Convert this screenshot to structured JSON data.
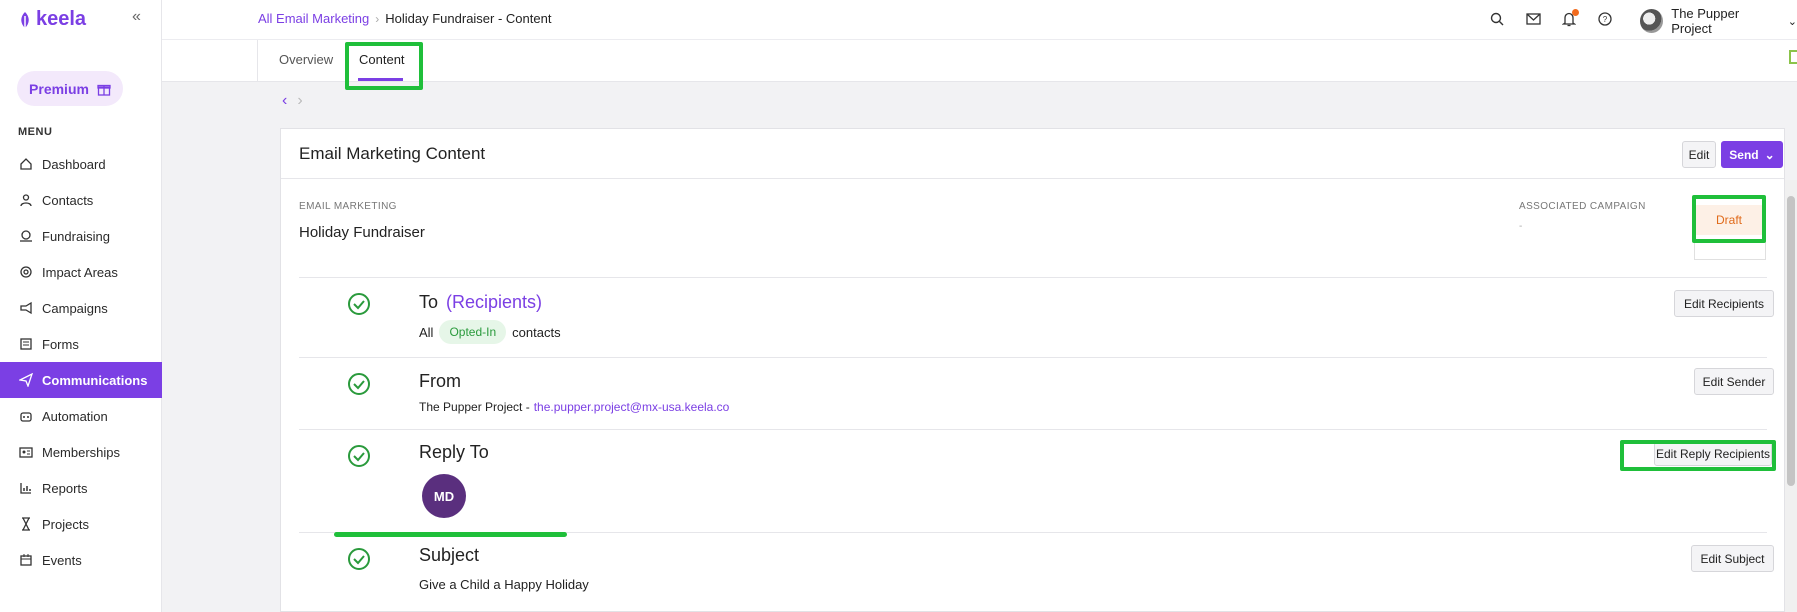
{
  "app": {
    "logo_text": "keela",
    "collapse_icon": "double-chevron-left-icon"
  },
  "sidebar": {
    "premium_label": "Premium",
    "menu_heading": "MENU",
    "items": [
      {
        "label": "Dashboard",
        "icon": "home-icon",
        "active": false
      },
      {
        "label": "Contacts",
        "icon": "user-icon",
        "active": false
      },
      {
        "label": "Fundraising",
        "icon": "fundraising-icon",
        "active": false
      },
      {
        "label": "Impact Areas",
        "icon": "impact-icon",
        "active": false
      },
      {
        "label": "Campaigns",
        "icon": "megaphone-icon",
        "active": false
      },
      {
        "label": "Forms",
        "icon": "form-icon",
        "active": false
      },
      {
        "label": "Communications",
        "icon": "send-icon",
        "active": true
      },
      {
        "label": "Automation",
        "icon": "robot-icon",
        "active": false
      },
      {
        "label": "Memberships",
        "icon": "id-card-icon",
        "active": false
      },
      {
        "label": "Reports",
        "icon": "bar-chart-icon",
        "active": false
      },
      {
        "label": "Projects",
        "icon": "hourglass-icon",
        "active": false
      },
      {
        "label": "Events",
        "icon": "calendar-icon",
        "active": false
      }
    ]
  },
  "header": {
    "breadcrumb_link": "All Email Marketing",
    "breadcrumb_current": "Holiday Fundraiser - Content",
    "org_name": "The Pupper Project"
  },
  "tabs": {
    "overview": "Overview",
    "content": "Content"
  },
  "card": {
    "title": "Email Marketing Content",
    "edit_label": "Edit",
    "send_label": "Send",
    "email_marketing_label": "EMAIL MARKETING",
    "email_marketing_value": "Holiday Fundraiser",
    "associated_campaign_label": "ASSOCIATED CAMPAIGN",
    "associated_campaign_value": "-",
    "status": "Draft"
  },
  "sections": {
    "to": {
      "title": "To",
      "accent": "(Recipients)",
      "prefix": "All",
      "pill": "Opted-In",
      "suffix": "contacts",
      "button": "Edit Recipients"
    },
    "from": {
      "title": "From",
      "name": "The Pupper Project -",
      "email": "the.pupper.project@mx-usa.keela.co",
      "button": "Edit Sender"
    },
    "reply": {
      "title": "Reply To",
      "avatar": "MD",
      "button": "Edit Reply Recipients"
    },
    "subject": {
      "title": "Subject",
      "value": "Give a Child a Happy Holiday",
      "button": "Edit Subject"
    }
  },
  "colors": {
    "accent": "#7b3fe4",
    "highlight": "#1fbf3a",
    "success": "#2a9a3c",
    "draft": "#e06a1a"
  }
}
